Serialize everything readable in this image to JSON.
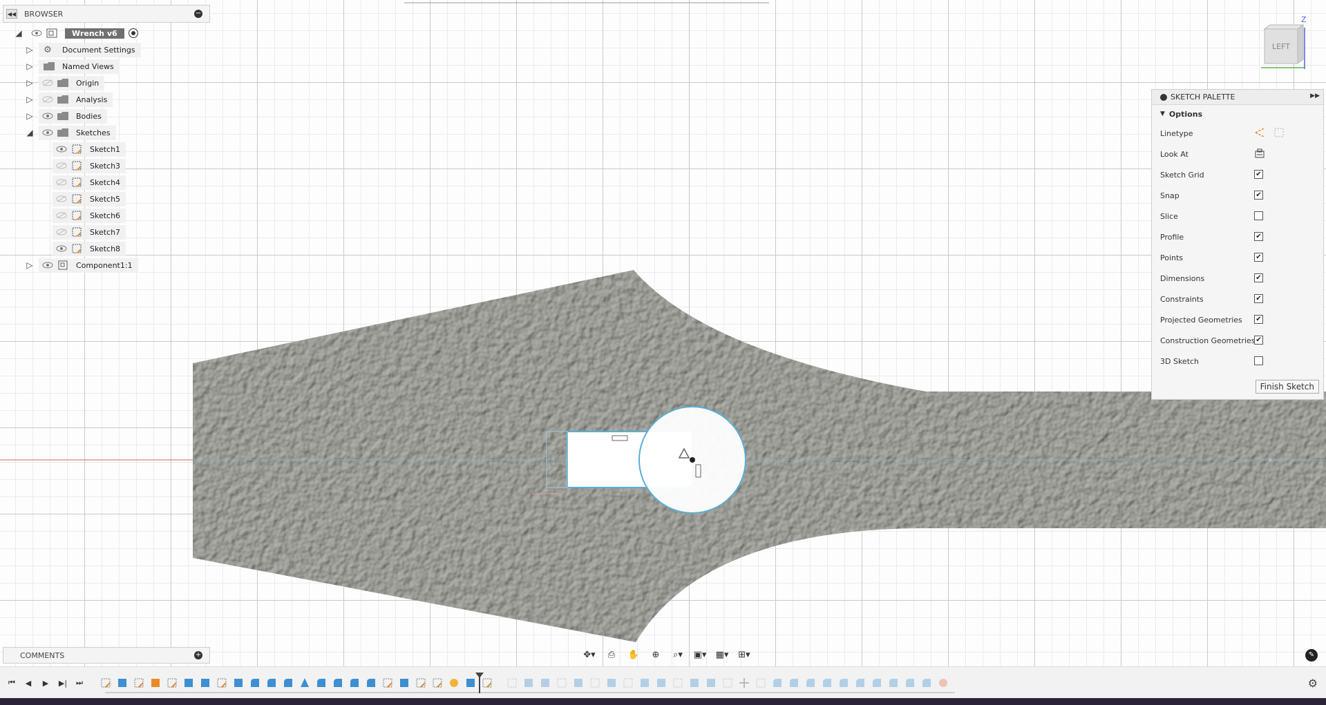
{
  "browser": {
    "title": "BROWSER",
    "root": "Wrench v6",
    "items": [
      {
        "label": "Document Settings",
        "icon": "gear-icon"
      },
      {
        "label": "Named Views",
        "icon": "folder-icon"
      },
      {
        "label": "Origin",
        "icon": "folder-icon"
      },
      {
        "label": "Analysis",
        "icon": "folder-icon"
      },
      {
        "label": "Bodies",
        "icon": "folder-icon"
      },
      {
        "label": "Sketches",
        "icon": "folder-icon"
      }
    ],
    "sketches": [
      "Sketch1",
      "Sketch3",
      "Sketch4",
      "Sketch5",
      "Sketch6",
      "Sketch7",
      "Sketch8"
    ],
    "component": "Component1:1"
  },
  "comments": {
    "title": "COMMENTS"
  },
  "viewcube": {
    "face": "LEFT",
    "axis": "Z"
  },
  "palette": {
    "title": "SKETCH PALETTE",
    "section": "Options",
    "rows": [
      {
        "label": "Linetype",
        "type": "icons"
      },
      {
        "label": "Look At",
        "type": "icon"
      },
      {
        "label": "Sketch Grid",
        "checked": true
      },
      {
        "label": "Snap",
        "checked": true
      },
      {
        "label": "Slice",
        "checked": false
      },
      {
        "label": "Profile",
        "checked": true
      },
      {
        "label": "Points",
        "checked": true
      },
      {
        "label": "Dimensions",
        "checked": true
      },
      {
        "label": "Constraints",
        "checked": true
      },
      {
        "label": "Projected Geometries",
        "checked": true
      },
      {
        "label": "Construction Geometries",
        "checked": true
      },
      {
        "label": "3D Sketch",
        "checked": false
      }
    ],
    "finish": "Finish Sketch"
  },
  "colors": {
    "accent": "#5aaed4",
    "body": "#8c8c86",
    "constraint_red": "#e06060"
  }
}
